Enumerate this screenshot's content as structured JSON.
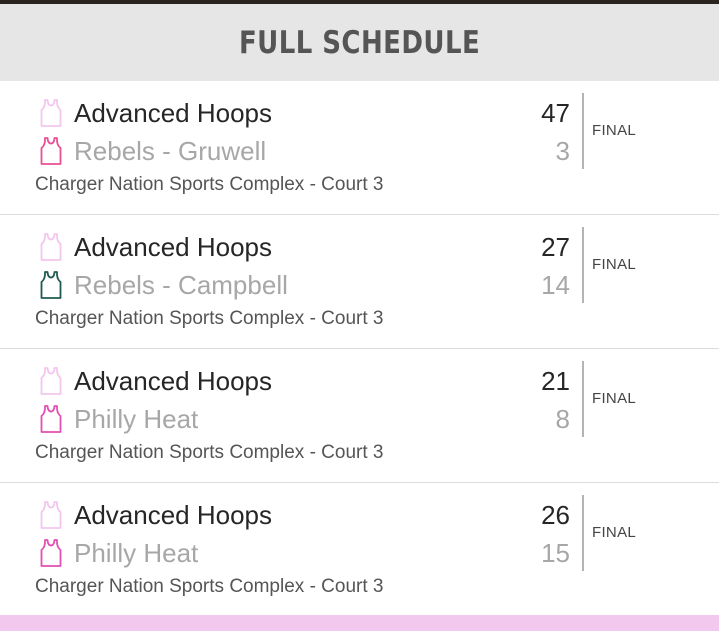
{
  "header": {
    "title": "FULL SCHEDULE"
  },
  "colors": {
    "header_bg": "#e6e6e6",
    "footer_bar": "#f2c8ef"
  },
  "games": [
    {
      "home": {
        "name": "Advanced Hoops",
        "score": "47",
        "jersey_color": "#f4c6ee",
        "icon": "jersey-icon"
      },
      "away": {
        "name": "Rebels - Gruwell",
        "score": "3",
        "jersey_color": "#ea4f95",
        "icon": "jersey-icon"
      },
      "status": "FINAL",
      "venue": "Charger Nation Sports Complex - Court 3"
    },
    {
      "home": {
        "name": "Advanced Hoops",
        "score": "27",
        "jersey_color": "#f4c6ee",
        "icon": "jersey-icon"
      },
      "away": {
        "name": "Rebels - Campbell",
        "score": "14",
        "jersey_color": "#1f5a50",
        "icon": "jersey-icon"
      },
      "status": "FINAL",
      "venue": "Charger Nation Sports Complex - Court 3"
    },
    {
      "home": {
        "name": "Advanced Hoops",
        "score": "21",
        "jersey_color": "#f4c6ee",
        "icon": "jersey-icon"
      },
      "away": {
        "name": "Philly Heat",
        "score": "8",
        "jersey_color": "#e44fb2",
        "icon": "jersey-icon"
      },
      "status": "FINAL",
      "venue": "Charger Nation Sports Complex - Court 3"
    },
    {
      "home": {
        "name": "Advanced Hoops",
        "score": "26",
        "jersey_color": "#f4c6ee",
        "icon": "jersey-icon"
      },
      "away": {
        "name": "Philly Heat",
        "score": "15",
        "jersey_color": "#e44fb2",
        "icon": "jersey-icon"
      },
      "status": "FINAL",
      "venue": "Charger Nation Sports Complex - Court 3"
    }
  ]
}
